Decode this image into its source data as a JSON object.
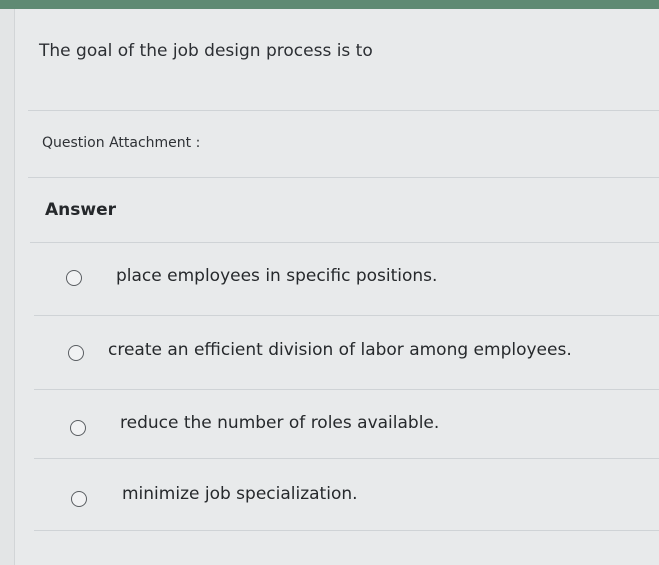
{
  "question": {
    "text": "The goal of the job design process is to",
    "attachment_label": "Question Attachment :"
  },
  "answer": {
    "heading": "Answer",
    "options": [
      {
        "label": "place employees in specific positions."
      },
      {
        "label": "create an efficient division of labor among employees."
      },
      {
        "label": "reduce the number of roles available."
      },
      {
        "label": "minimize job specialization."
      }
    ]
  }
}
